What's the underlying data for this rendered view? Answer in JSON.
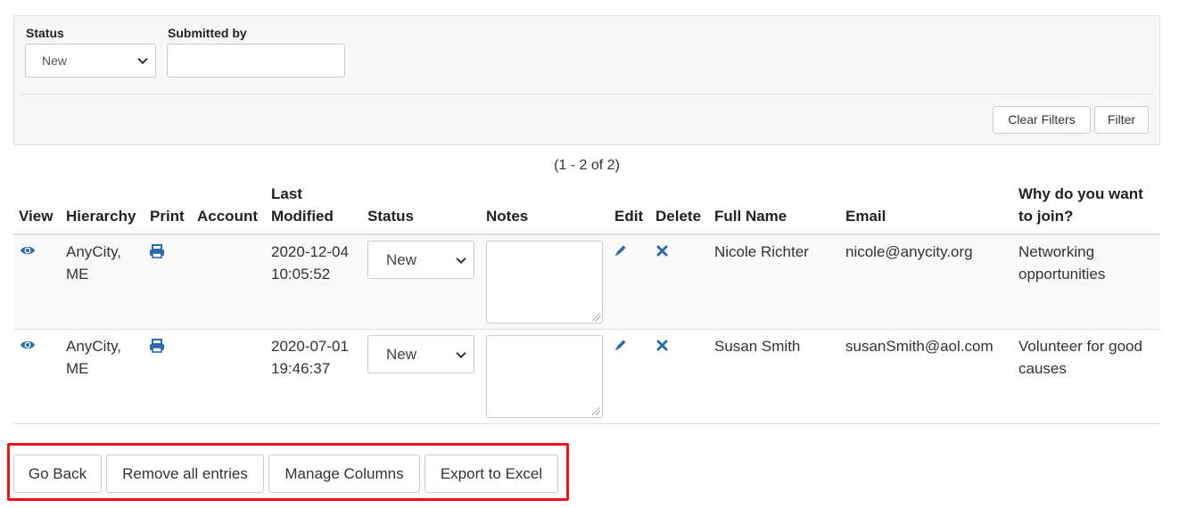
{
  "filters": {
    "status_label": "Status",
    "status_value": "New",
    "submitted_by_label": "Submitted by",
    "submitted_by_value": "",
    "clear_button": "Clear Filters",
    "filter_button": "Filter"
  },
  "pagination": {
    "text": "(1 - 2 of 2)"
  },
  "table": {
    "headers": {
      "view": "View",
      "hierarchy": "Hierarchy",
      "print": "Print",
      "account": "Account",
      "last_modified_1": "Last",
      "last_modified_2": "Modified",
      "status": "Status",
      "notes": "Notes",
      "edit": "Edit",
      "delete": "Delete",
      "full_name": "Full Name",
      "email": "Email",
      "why_join_1": "Why do you want",
      "why_join_2": "to join?"
    },
    "rows": [
      {
        "hierarchy_1": "AnyCity,",
        "hierarchy_2": "ME",
        "account": "",
        "date": "2020-12-04",
        "time": "10:05:52",
        "status": "New",
        "notes": "",
        "full_name": "Nicole Richter",
        "email": "nicole@anycity.org",
        "why_1": "Networking",
        "why_2": "opportunities"
      },
      {
        "hierarchy_1": "AnyCity,",
        "hierarchy_2": "ME",
        "account": "",
        "date": "2020-07-01",
        "time": "19:46:37",
        "status": "New",
        "notes": "",
        "full_name": "Susan Smith",
        "email": "susanSmith@aol.com",
        "why_1": "Volunteer for good",
        "why_2": "causes"
      }
    ]
  },
  "actions": {
    "go_back": "Go Back",
    "remove_all": "Remove all entries",
    "manage_columns": "Manage Columns",
    "export_excel": "Export to Excel"
  },
  "icons": {
    "view": "eye-icon",
    "print": "printer-icon",
    "edit": "pencil-icon",
    "delete": "x-icon"
  },
  "colors": {
    "link_blue": "#2c6aa8",
    "highlight_red": "#e8141c",
    "panel_bg": "#f7f7f7",
    "row_stripe": "#f9f9f9"
  }
}
